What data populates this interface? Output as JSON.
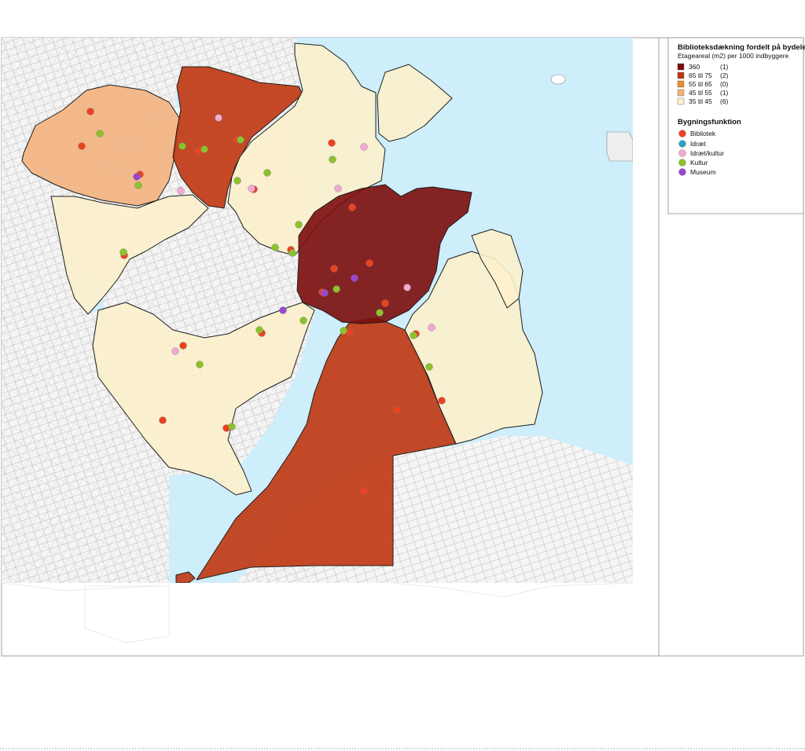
{
  "legend": {
    "title": "Biblioteksdækning fordelt på bydele",
    "subtitle": "Etageareal (m2) per 1000 indbyggere",
    "classes": [
      {
        "label": "360",
        "count": "(1)",
        "color": "#7b0c0c"
      },
      {
        "label": "65 til 75",
        "count": "(2)",
        "color": "#c0360f"
      },
      {
        "label": "55 til 65",
        "count": "(0)",
        "color": "#ea8a2a"
      },
      {
        "label": "45 til 55",
        "count": "(1)",
        "color": "#f4b27e"
      },
      {
        "label": "35 til 45",
        "count": "(6)",
        "color": "#fcefcc"
      }
    ],
    "function_title": "Bygningsfunktion",
    "functions": [
      {
        "label": "Bibliotek",
        "color": "#ef4020"
      },
      {
        "label": "Idræt",
        "color": "#2aa3c9"
      },
      {
        "label": "Idræt/kultur",
        "color": "#f2aad2"
      },
      {
        "label": "Kultur",
        "color": "#8cc22a"
      },
      {
        "label": "Museum",
        "color": "#9b45d0"
      }
    ]
  },
  "colors": {
    "water": "#cdeefa",
    "land": "#f5f5f5",
    "border": "#1e1e1e"
  }
}
